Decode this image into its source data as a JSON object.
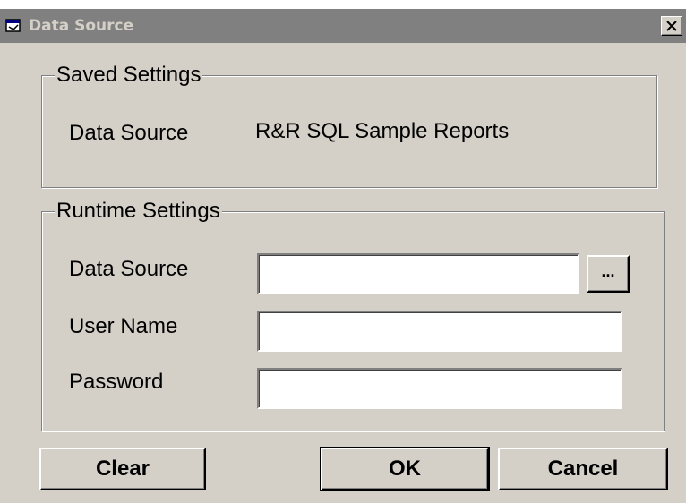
{
  "window": {
    "title": "Data Source",
    "close_glyph": "✕",
    "title_bar_color": "#808080",
    "face_color": "#d4d0c8"
  },
  "saved_settings": {
    "legend": "Saved Settings",
    "data_source_label": "Data Source",
    "data_source_value": "R&R SQL Sample Reports"
  },
  "runtime_settings": {
    "legend": "Runtime Settings",
    "data_source_label": "Data Source",
    "data_source_value": "",
    "browse_label": "...",
    "user_name_label": "User Name",
    "user_name_value": "",
    "password_label": "Password",
    "password_value": ""
  },
  "buttons": {
    "clear": "Clear",
    "ok": "OK",
    "cancel": "Cancel"
  },
  "icons": {
    "title_icon": "window-app-icon",
    "close_icon": "close-icon"
  }
}
